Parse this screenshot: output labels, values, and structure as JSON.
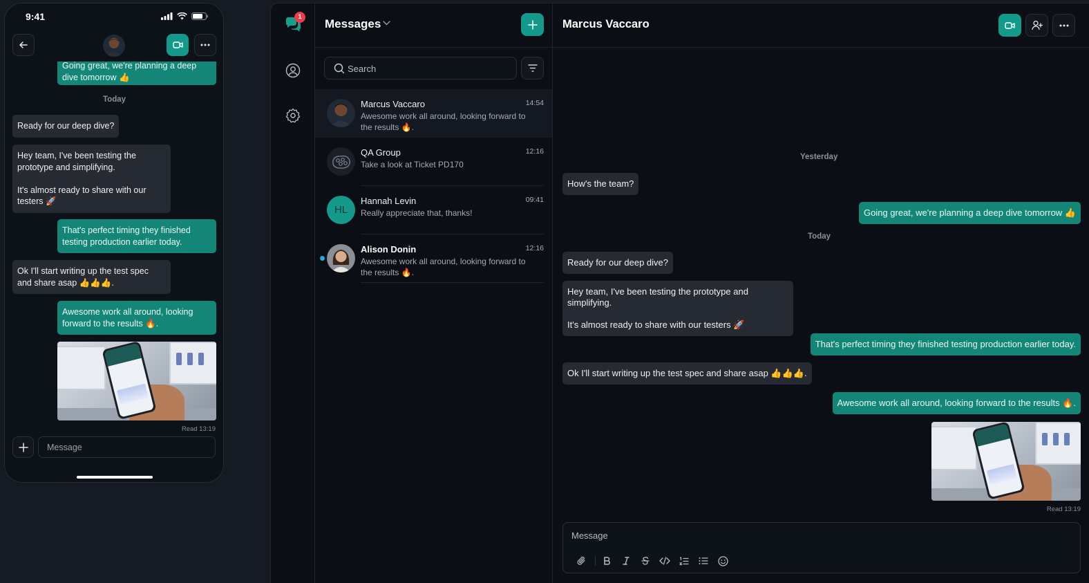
{
  "phone": {
    "status_time": "9:41",
    "messages": [
      {
        "dir": "out",
        "text": "Going great, we're planning a deep\ndive tomorrow 👍"
      },
      {
        "dir": "day",
        "text": "Today"
      },
      {
        "dir": "in",
        "text": "Ready for our deep dive?"
      },
      {
        "dir": "in",
        "text": "Hey team, I've been testing the\nprototype and simplifying.\n\nIt's almost ready to share with our\ntesters 🚀"
      },
      {
        "dir": "out",
        "text": "That's perfect timing they finished\ntesting production earlier today."
      },
      {
        "dir": "in",
        "text": "Ok I'll start writing up the test spec\nand share asap 👍👍👍."
      },
      {
        "dir": "out",
        "text": "Awesome work all around, looking\nforward to the results 🔥."
      }
    ],
    "read_receipt": "Read 13:19",
    "compose_placeholder": "Message"
  },
  "rail": {
    "notification_count": "1"
  },
  "conversations": {
    "title": "Messages",
    "search_placeholder": "Search",
    "items": [
      {
        "name": "Marcus Vaccaro",
        "time": "14:54",
        "preview": "Awesome work all around, looking forward to the results 🔥.",
        "active": true
      },
      {
        "name": "QA Group",
        "time": "12:16",
        "preview": "Take a look at Ticket PD170"
      },
      {
        "name": "Hannah Levin",
        "initials": "HL",
        "time": "09:41",
        "preview": "Really appreciate that, thanks!"
      },
      {
        "name": "Alison Donin",
        "time": "12:16",
        "preview": "Awesome work all around, looking forward to the results 🔥.",
        "unread": true
      }
    ]
  },
  "chat": {
    "title": "Marcus Vaccaro",
    "day_yesterday": "Yesterday",
    "day_today": "Today",
    "messages": [
      {
        "dir": "in",
        "text": "How's the team?"
      },
      {
        "dir": "out",
        "text": "Going great, we're planning a deep dive tomorrow 👍"
      },
      {
        "dir": "in",
        "text": "Ready for our deep dive?"
      },
      {
        "dir": "in",
        "text": "Hey team, I've been testing the prototype and simplifying.\n\nIt's almost ready to share with our testers 🚀"
      },
      {
        "dir": "out",
        "text": "That's perfect timing they finished testing production earlier today."
      },
      {
        "dir": "in",
        "text": "Ok I'll start writing up the test spec and share asap 👍👍👍."
      },
      {
        "dir": "out",
        "text": "Awesome work all around, looking forward to the results 🔥."
      }
    ],
    "read_receipt": "Read 13:19",
    "composer_placeholder": "Message"
  },
  "colors": {
    "accent": "#139a8b",
    "outgoing_bubble": "#138678",
    "incoming_bubble": "#252a33",
    "badge": "#ef3b4a",
    "unread_dot": "#2aa6e0"
  },
  "icons": [
    "back-arrow-icon",
    "video-call-icon",
    "more-icon",
    "plus-icon",
    "chat-bubbles-icon",
    "profile-icon",
    "settings-icon",
    "chevron-down-icon",
    "search-icon",
    "filter-icon",
    "add-user-icon",
    "attach-icon",
    "bold-icon",
    "italic-icon",
    "strikethrough-icon",
    "code-icon",
    "numbered-list-icon",
    "bullet-list-icon",
    "emoji-icon"
  ]
}
